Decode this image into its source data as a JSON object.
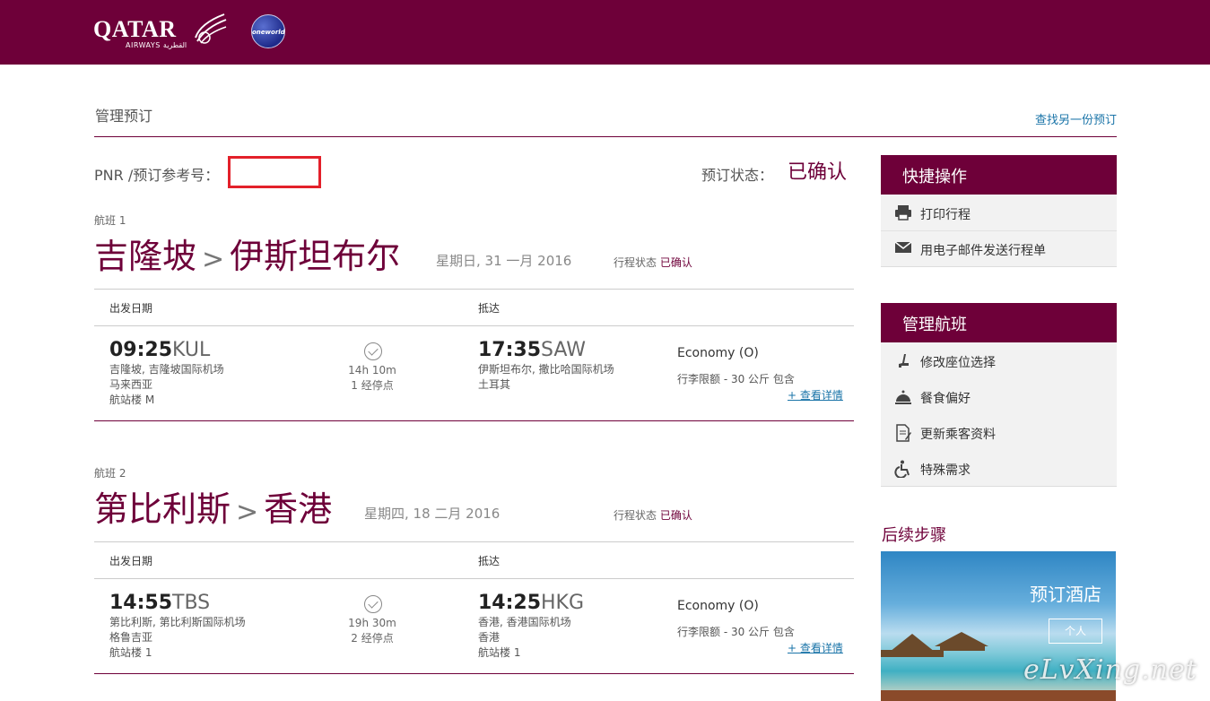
{
  "header": {
    "logo_text": "QATAR",
    "logo_subtext": "AIRWAYS القطرية",
    "alliance": "oneworld",
    "brand_color": "#6e0039"
  },
  "page": {
    "title": "管理预订",
    "find_another": "查找另一份预订"
  },
  "booking": {
    "pnr_label": "PNR /预订参考号：",
    "status_label": "预订状态：",
    "status_value": "已确认"
  },
  "flights": [
    {
      "label": "航班 1",
      "from_city": "吉隆坡",
      "arrow": ">",
      "to_city": "伊斯坦布尔",
      "date": "星期日, 31 一月 2016",
      "trip_status_label": "行程状态",
      "trip_status_value": "已确认",
      "depart_head": "出发日期",
      "arrive_head": "抵达",
      "depart_time": "09:25",
      "depart_code": "KUL",
      "depart_airport": "吉隆坡, 吉隆坡国际机场",
      "depart_country": "马来西亚",
      "depart_terminal": "航站楼 M",
      "duration": "14h 10m",
      "stops": "1 经停点",
      "arrive_time": "17:35",
      "arrive_code": "SAW",
      "arrive_airport": "伊斯坦布尔, 撒比哈国际机场",
      "arrive_country": "土耳其",
      "arrive_terminal": "",
      "cabin": "Economy (O)",
      "baggage": "行李限额 - 30 公斤 包含",
      "details": "+ 查看详情"
    },
    {
      "label": "航班 2",
      "from_city": "第比利斯",
      "arrow": ">",
      "to_city": "香港",
      "date": "星期四, 18 二月 2016",
      "trip_status_label": "行程状态",
      "trip_status_value": "已确认",
      "depart_head": "出发日期",
      "arrive_head": "抵达",
      "depart_time": "14:55",
      "depart_code": "TBS",
      "depart_airport": "第比利斯, 第比利斯国际机场",
      "depart_country": "格鲁吉亚",
      "depart_terminal": "航站楼 1",
      "duration": "19h 30m",
      "stops": "2 经停点",
      "arrive_time": "14:25",
      "arrive_code": "HKG",
      "arrive_airport": "香港, 香港国际机场",
      "arrive_country": "香港",
      "arrive_terminal": "航站楼 1",
      "cabin": "Economy (O)",
      "baggage": "行李限额 - 30 公斤 包含",
      "details": "+ 查看详情"
    }
  ],
  "quick_actions": {
    "title": "快捷操作",
    "items": [
      {
        "label": "打印行程",
        "icon": "printer-icon"
      },
      {
        "label": "用电子邮件发送行程单",
        "icon": "envelope-icon"
      }
    ]
  },
  "manage_flight": {
    "title": "管理航班",
    "items": [
      {
        "label": "修改座位选择",
        "icon": "seat-icon"
      },
      {
        "label": "餐食偏好",
        "icon": "meal-icon"
      },
      {
        "label": "更新乘客资料",
        "icon": "document-edit-icon"
      },
      {
        "label": "特殊需求",
        "icon": "wheelchair-icon"
      }
    ]
  },
  "next_steps": {
    "title": "后续步骤",
    "hotel_title": "预订酒店",
    "hotel_button": "个人"
  },
  "watermark": "eLvXing.net"
}
